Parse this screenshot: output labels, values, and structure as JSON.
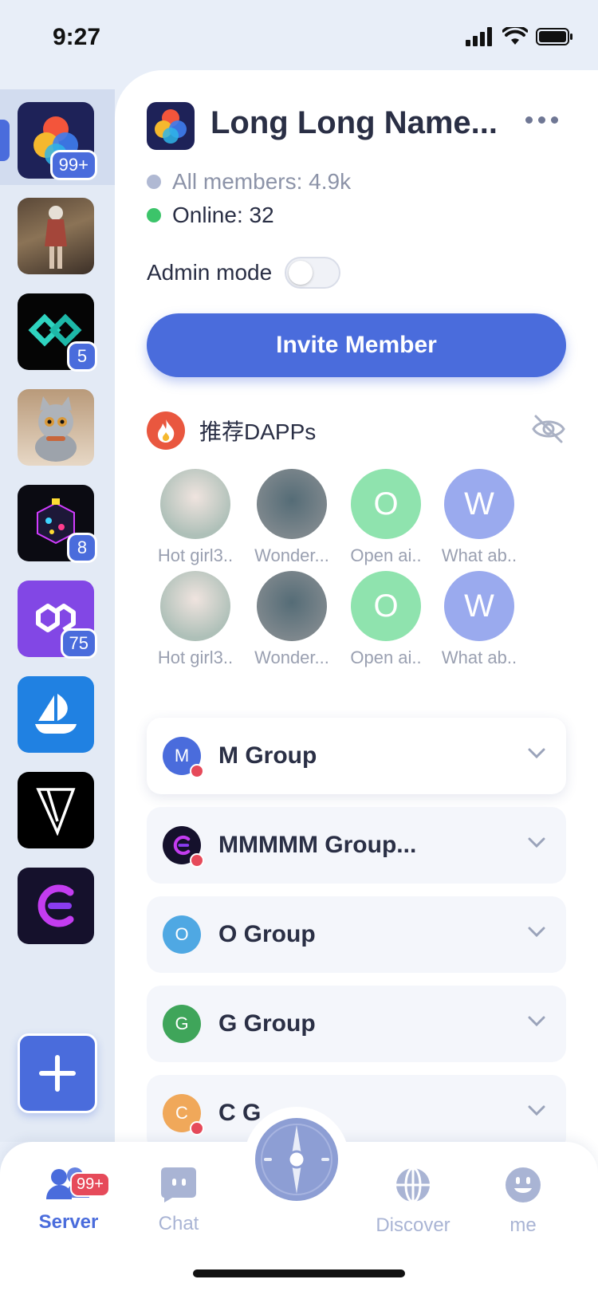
{
  "status": {
    "time": "9:27"
  },
  "sidebar": {
    "servers": [
      {
        "name": "server-1",
        "badge": "99+"
      },
      {
        "name": "server-2",
        "badge": ""
      },
      {
        "name": "server-3",
        "badge": "5"
      },
      {
        "name": "server-4",
        "badge": ""
      },
      {
        "name": "server-5",
        "badge": "8"
      },
      {
        "name": "server-6",
        "badge": "75"
      },
      {
        "name": "server-7",
        "badge": ""
      },
      {
        "name": "server-8",
        "badge": ""
      },
      {
        "name": "server-9",
        "badge": ""
      }
    ]
  },
  "header": {
    "server_name": "Long Long Name..."
  },
  "stats": {
    "all_members": "All members: 4.9k",
    "online": "Online: 32"
  },
  "admin": {
    "label": "Admin mode"
  },
  "invite": {
    "label": "Invite Member"
  },
  "dapps": {
    "title": "推荐DAPPs",
    "items": [
      {
        "label": "Hot girl3..",
        "letter": ""
      },
      {
        "label": "Wonder...",
        "letter": ""
      },
      {
        "label": "Open ai..",
        "letter": "O"
      },
      {
        "label": "What ab..",
        "letter": "W"
      },
      {
        "label": "Hot girl3..",
        "letter": ""
      },
      {
        "label": "Wonder...",
        "letter": ""
      },
      {
        "label": "Open ai..",
        "letter": "O"
      },
      {
        "label": "What ab..",
        "letter": "W"
      }
    ]
  },
  "groups": [
    {
      "name": "M Group",
      "letter": "M"
    },
    {
      "name": "MMMMM Group...",
      "letter": ""
    },
    {
      "name": "O Group",
      "letter": "O"
    },
    {
      "name": "G Group",
      "letter": "G"
    },
    {
      "name": "C G",
      "letter": "C"
    }
  ],
  "nav": {
    "server": "Server",
    "server_badge": "99+",
    "chat": "Chat",
    "discover": "Discover",
    "me": "me"
  },
  "colors": {
    "accent": "#4a6cdc",
    "online": "#3cc46a",
    "members": "#b0b9d3",
    "badge_red": "#e64a5a"
  }
}
